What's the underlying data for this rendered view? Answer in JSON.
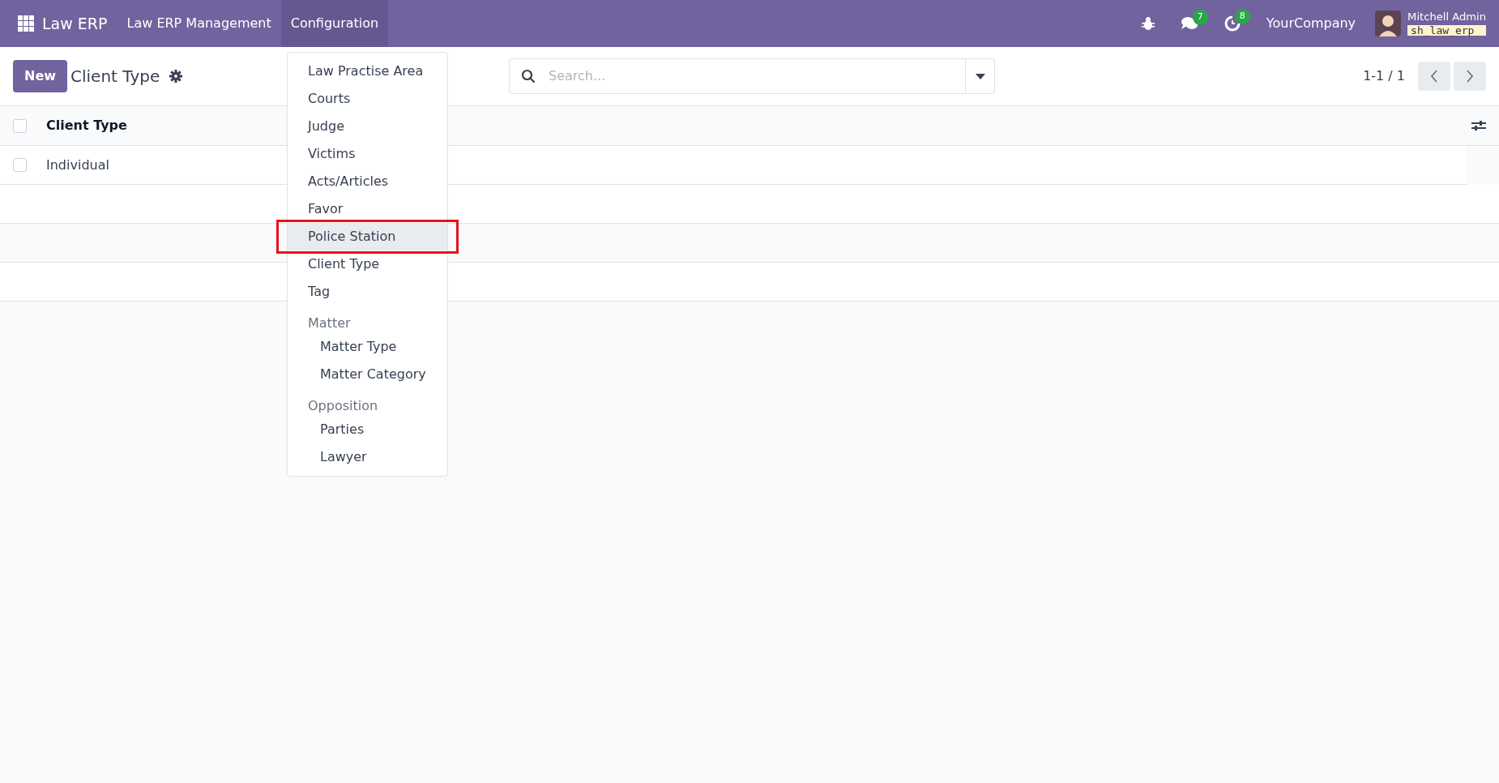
{
  "navbar": {
    "brand": "Law ERP",
    "menus": [
      {
        "label": "Law ERP Management",
        "selected": false
      },
      {
        "label": "Configuration",
        "selected": true
      }
    ],
    "messages_badge": "7",
    "activities_badge": "8",
    "company": "YourCompany",
    "user": "Mitchell Admin",
    "database": "sh_law_erp"
  },
  "control_panel": {
    "new_button": "New",
    "title": "Client Type",
    "search": {
      "placeholder": "Search..."
    },
    "pager": "1-1 / 1"
  },
  "table": {
    "columns": [
      "Client Type"
    ],
    "rows": [
      {
        "cells": [
          "Individual"
        ],
        "checked": false
      }
    ],
    "select_all_checked": false
  },
  "menu": [
    {
      "kind": "item",
      "label": "Law Practise Area",
      "hovered": false,
      "annotated": false
    },
    {
      "kind": "item",
      "label": "Courts",
      "hovered": false,
      "annotated": false
    },
    {
      "kind": "item",
      "label": "Judge",
      "hovered": false,
      "annotated": false
    },
    {
      "kind": "item",
      "label": "Victims",
      "hovered": false,
      "annotated": false
    },
    {
      "kind": "item",
      "label": "Acts/Articles",
      "hovered": false,
      "annotated": false
    },
    {
      "kind": "item",
      "label": "Favor",
      "hovered": false,
      "annotated": false
    },
    {
      "kind": "item",
      "label": "Police Station",
      "hovered": true,
      "annotated": true
    },
    {
      "kind": "item",
      "label": "Client Type",
      "hovered": false,
      "annotated": false
    },
    {
      "kind": "item",
      "label": "Tag",
      "hovered": false,
      "annotated": false
    },
    {
      "kind": "header",
      "label": "Matter",
      "children": [
        {
          "label": "Matter Type"
        },
        {
          "label": "Matter Category"
        }
      ]
    },
    {
      "kind": "header",
      "label": "Opposition",
      "children": [
        {
          "label": "Parties"
        },
        {
          "label": "Lawyer"
        }
      ]
    }
  ]
}
